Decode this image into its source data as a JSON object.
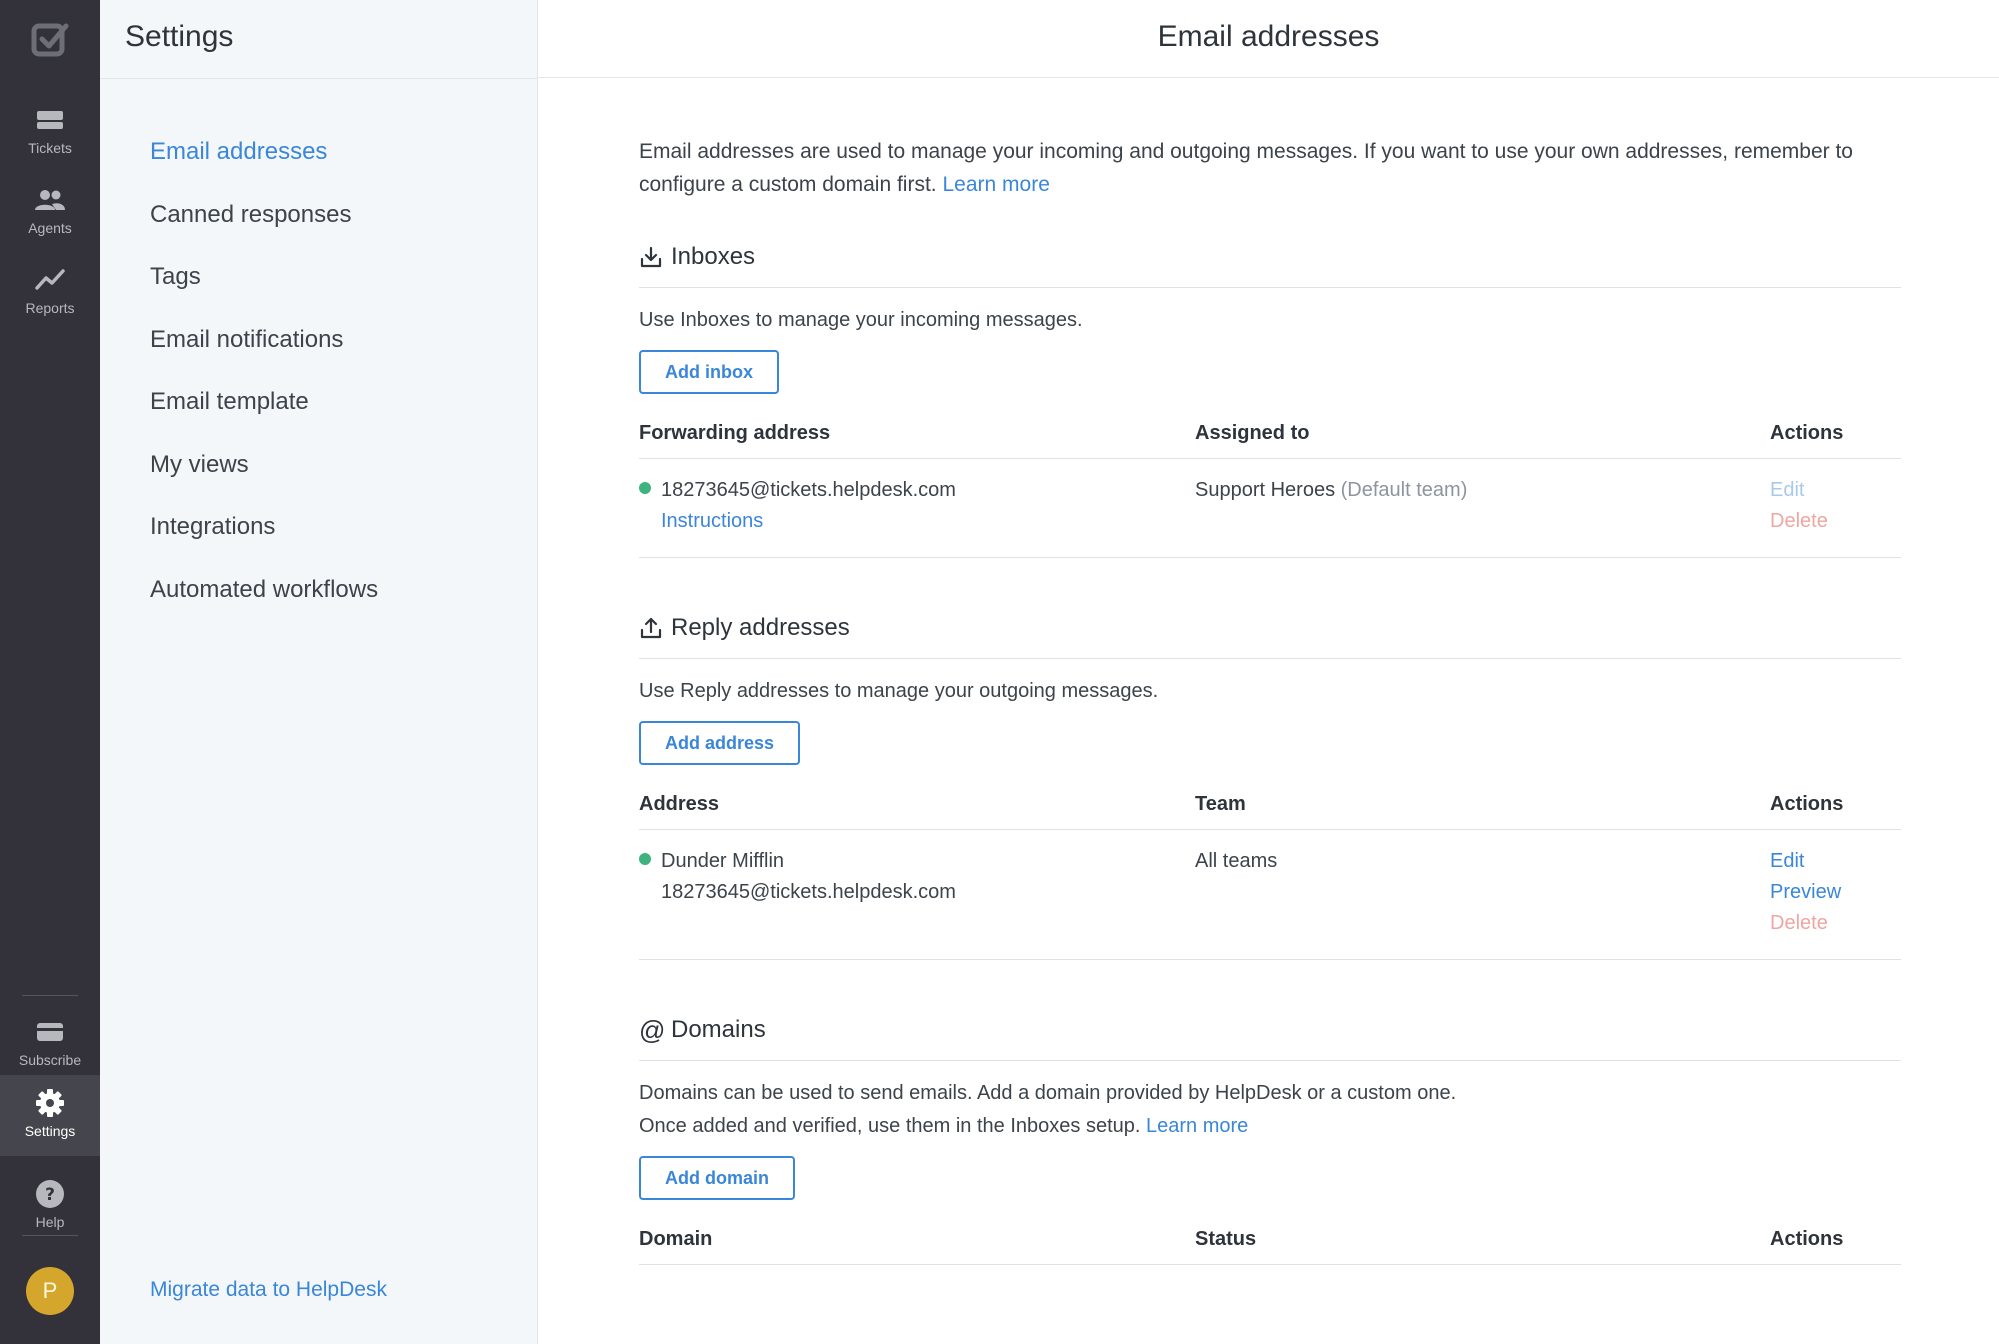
{
  "rail": {
    "items": [
      {
        "label": "Tickets",
        "icon": "ticket-icon"
      },
      {
        "label": "Agents",
        "icon": "agents-icon"
      },
      {
        "label": "Reports",
        "icon": "reports-icon"
      }
    ],
    "bottom": [
      {
        "label": "Subscribe",
        "icon": "card-icon"
      },
      {
        "label": "Settings",
        "icon": "gear-icon"
      },
      {
        "label": "Help",
        "icon": "help-icon"
      }
    ],
    "avatar": "P"
  },
  "sidebar": {
    "title": "Settings",
    "items": [
      {
        "label": "Email addresses"
      },
      {
        "label": "Canned responses"
      },
      {
        "label": "Tags"
      },
      {
        "label": "Email notifications"
      },
      {
        "label": "Email template"
      },
      {
        "label": "My views"
      },
      {
        "label": "Integrations"
      },
      {
        "label": "Automated workflows"
      }
    ],
    "migrate": "Migrate data to HelpDesk"
  },
  "main": {
    "title": "Email addresses",
    "intro": "Email addresses are used to manage your incoming and outgoing messages. If you want to use your own addresses, remember to configure a custom domain first.",
    "intro_link": "Learn more",
    "inboxes": {
      "title": "Inboxes",
      "desc": "Use Inboxes to manage your incoming messages.",
      "button": "Add inbox",
      "headers": [
        "Forwarding address",
        "Assigned to",
        "Actions"
      ],
      "row": {
        "address": "18273645@tickets.helpdesk.com",
        "instructions": "Instructions",
        "assigned": "Support Heroes",
        "assigned_note": "(Default team)",
        "edit": "Edit",
        "delete": "Delete"
      }
    },
    "reply": {
      "title": "Reply addresses",
      "desc": "Use Reply addresses to manage your outgoing messages.",
      "button": "Add address",
      "headers": [
        "Address",
        "Team",
        "Actions"
      ],
      "row": {
        "name": "Dunder Mifflin",
        "address": "18273645@tickets.helpdesk.com",
        "team": "All teams",
        "edit": "Edit",
        "preview": "Preview",
        "delete": "Delete"
      }
    },
    "domains": {
      "title": "Domains",
      "desc1": "Domains can be used to send emails. Add a domain provided by HelpDesk or a custom one.",
      "desc2": "Once added and verified, use them in the Inboxes setup.",
      "desc_link": "Learn more",
      "button": "Add domain",
      "headers": [
        "Domain",
        "Status",
        "Actions"
      ]
    }
  },
  "colors": {
    "accent": "#3a86d8",
    "rail": "#33323a",
    "status_dot": "#3fb37f",
    "delete": "#eda6a2",
    "avatar": "#d4a72c"
  }
}
